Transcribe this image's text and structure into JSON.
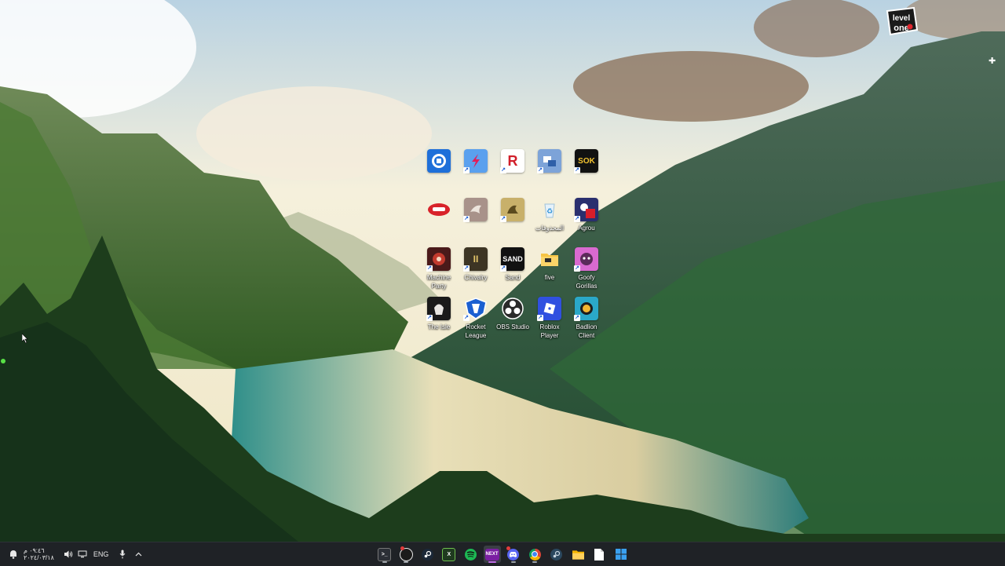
{
  "brand": {
    "logo_text": "level one"
  },
  "desktop": {
    "icons": [
      {
        "label": "",
        "icon": "screen-capture-icon"
      },
      {
        "label": "",
        "icon": "bolt-app-icon"
      },
      {
        "label": "",
        "icon": "r-game-icon"
      },
      {
        "label": "",
        "icon": "transfer-tool-icon"
      },
      {
        "label": "",
        "icon": "game-logo-icon",
        "tile_text": "SOK"
      },
      {
        "label": "",
        "icon": "red-helmet-icon"
      },
      {
        "label": "",
        "icon": "dove-game-icon"
      },
      {
        "label": "",
        "icon": "parchment-game-icon"
      },
      {
        "label": "المحذوفات",
        "icon": "recycle-bin-icon"
      },
      {
        "label": "Agrou",
        "icon": "agrou-icon"
      },
      {
        "label": "Machine Party",
        "icon": "gear-game-icon"
      },
      {
        "label": "Chivalry",
        "icon": "shield-game-icon",
        "tile_text": "II"
      },
      {
        "label": "Sand",
        "icon": "sand-icon",
        "tile_text": "SAND"
      },
      {
        "label": "five",
        "icon": "folder-icon"
      },
      {
        "label": "Goofy Gorillas",
        "icon": "gorilla-icon"
      },
      {
        "label": "The Isle",
        "icon": "skull-icon"
      },
      {
        "label": "Rocket League",
        "icon": "rocket-league-icon"
      },
      {
        "label": "OBS Studio",
        "icon": "obs-icon"
      },
      {
        "label": "Roblox Player",
        "icon": "roblox-icon"
      },
      {
        "label": "Badlion Client",
        "icon": "badlion-icon"
      }
    ]
  },
  "taskbar": {
    "clock_time": "٠٩:٤٦ م",
    "clock_date": "٢٠٢٤/٠٣/١٨",
    "language": "ENG",
    "apps": [
      {
        "name": "terminal",
        "icon": "terminal-icon",
        "text": ">_",
        "color": "#2b2f36"
      },
      {
        "name": "obs",
        "icon": "obs-icon",
        "text": "",
        "color": "#1b1b1b"
      },
      {
        "name": "steam",
        "icon": "steam-icon",
        "text": "",
        "color": "#1b2838"
      },
      {
        "name": "xbox",
        "icon": "xbox-icon",
        "text": "X",
        "color": "#1f3a1f"
      },
      {
        "name": "spotify",
        "icon": "spotify-icon",
        "text": "",
        "color": "#1db954"
      },
      {
        "name": "next",
        "icon": "next-icon",
        "text": "NEXT",
        "color": "#7a1fa2"
      },
      {
        "name": "discord",
        "icon": "discord-icon",
        "text": "",
        "color": "#5865f2"
      },
      {
        "name": "chrome",
        "icon": "chrome-icon",
        "text": "",
        "color": "#db4437"
      },
      {
        "name": "steam-2",
        "icon": "steam-icon",
        "text": "",
        "color": "#2a475e"
      },
      {
        "name": "file-explorer",
        "icon": "folder-icon",
        "text": "",
        "color": "#f4c430"
      },
      {
        "name": "notepad",
        "icon": "document-icon",
        "text": "",
        "color": "#ffffff"
      },
      {
        "name": "start",
        "icon": "windows-icon",
        "text": "",
        "color": "#3aa0f0"
      }
    ]
  },
  "colors": {
    "taskbar_bg": "#1f2226",
    "icon_label": "#ffffff"
  }
}
